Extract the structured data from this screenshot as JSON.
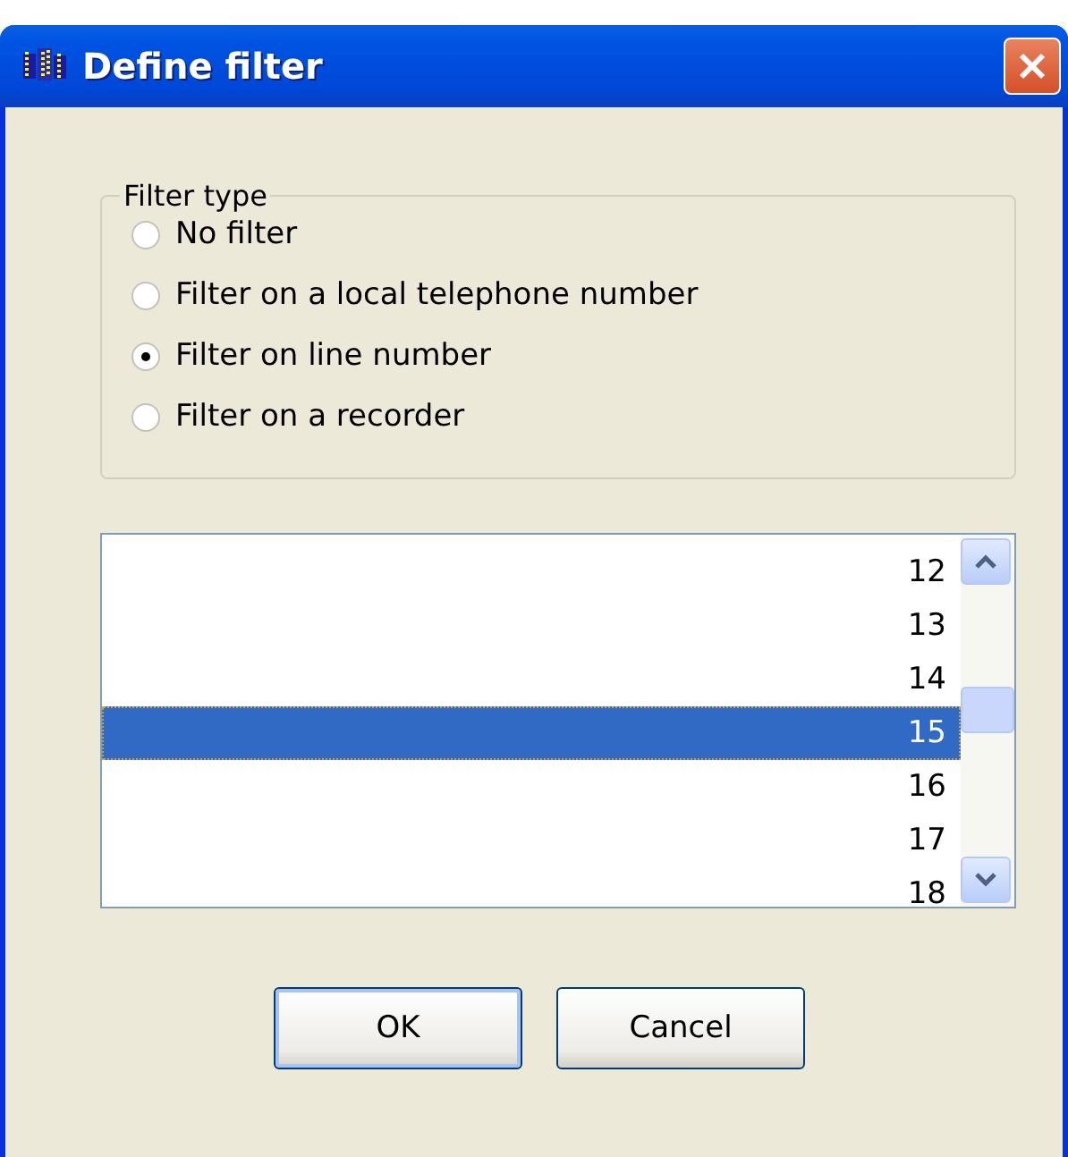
{
  "window": {
    "title": "Define filter"
  },
  "filter_type": {
    "label": "Filter type",
    "options": [
      {
        "label": "No filter",
        "selected": false
      },
      {
        "label": "Filter on a local telephone number",
        "selected": false
      },
      {
        "label": "Filter on line number",
        "selected": true
      },
      {
        "label": "Filter on a recorder",
        "selected": false
      }
    ]
  },
  "list": {
    "items": [
      {
        "label": "12",
        "selected": false
      },
      {
        "label": "13",
        "selected": false
      },
      {
        "label": "14",
        "selected": false
      },
      {
        "label": "15",
        "selected": true
      },
      {
        "label": "16",
        "selected": false
      },
      {
        "label": "17",
        "selected": false
      },
      {
        "label": "18",
        "selected": false
      }
    ]
  },
  "buttons": [
    "OK",
    "Cancel"
  ]
}
